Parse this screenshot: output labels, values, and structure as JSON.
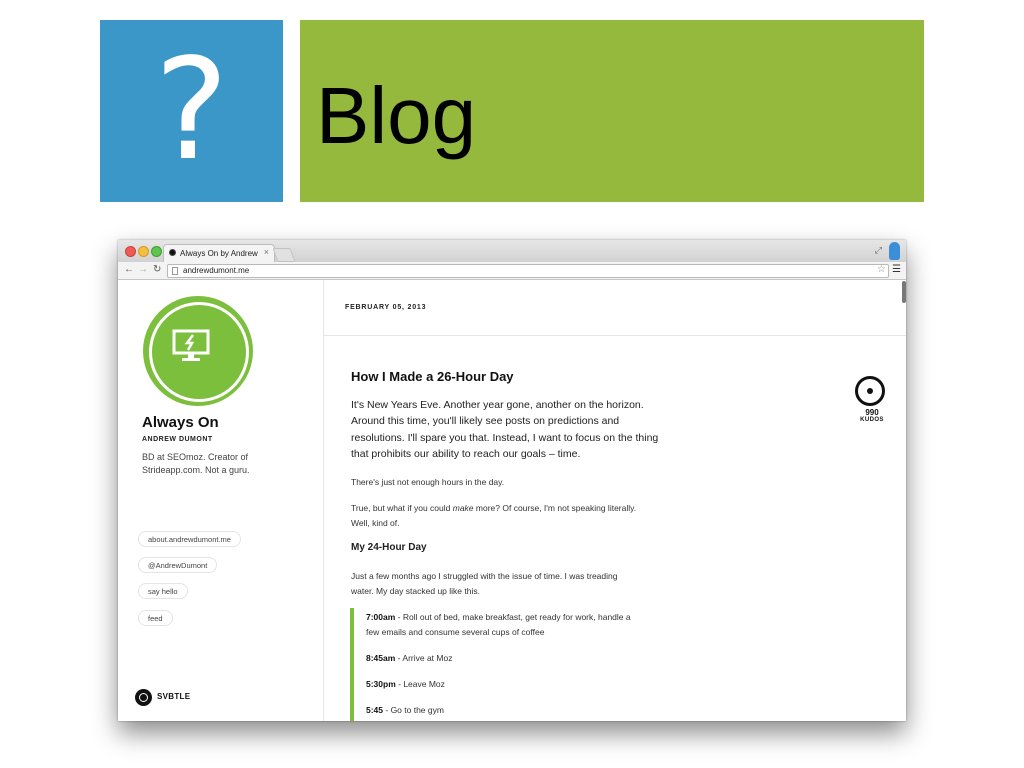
{
  "slide": {
    "question_mark": "?",
    "title": "Blog"
  },
  "browser": {
    "tab_title": "Always On by Andrew Dum",
    "tab_close": "×",
    "url": "andrewdumont.me"
  },
  "sidebar": {
    "blog_name": "Always On",
    "author": "ANDREW DUMONT",
    "bio": "BD at SEOmoz. Creator of Strideapp.com. Not a guru.",
    "links": [
      {
        "label": "about.andrewdumont.me"
      },
      {
        "label": "@AndrewDumont"
      },
      {
        "label": "say hello"
      },
      {
        "label": "feed"
      }
    ],
    "footer_brand": "SVBTLE"
  },
  "post": {
    "date": "FEBRUARY 05, 2013",
    "title": "How I Made a 26-Hour Day",
    "lead": "It's New Years Eve. Another year gone, another on the horizon. Around this time, you'll likely see posts on predictions and resolutions. I'll spare you that. Instead, I want to focus on the thing that prohibits our ability to reach our goals – time.",
    "p1": "There's just not enough hours in the day.",
    "p2_before": "True, but what if you could ",
    "p2_em": "make",
    "p2_after": " more? Of course, I'm not speaking literally. Well, kind of.",
    "subheading": "My 24-Hour Day",
    "p3": "Just a few months ago I struggled with the issue of time. I was treading water. My day stacked up like this.",
    "schedule": [
      {
        "time": "7:00am",
        "text": " - Roll out of bed, make breakfast, get ready for work, handle a few emails and consume several cups of coffee"
      },
      {
        "time": "8:45am",
        "text": " - Arrive at Moz"
      },
      {
        "time": "5:30pm",
        "text": " - Leave Moz"
      },
      {
        "time": "5:45",
        "text": " - Go to the gym"
      }
    ],
    "kudos_count": "990",
    "kudos_label": "KUDOS"
  },
  "colors": {
    "slide_blue": "#3b97c7",
    "slide_green": "#94b93c",
    "accent_green": "#7bbf3d"
  }
}
